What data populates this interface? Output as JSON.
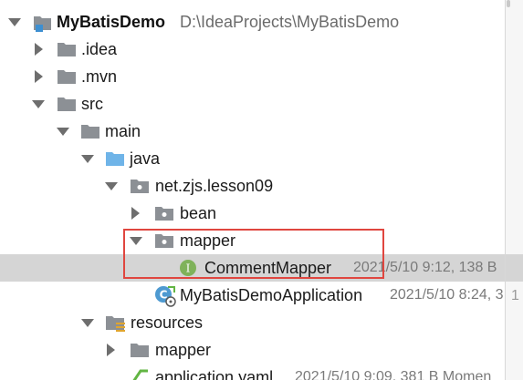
{
  "colors": {
    "selection": "#d5d5d5",
    "highlight_border": "#e0463f",
    "folder": "#8c9095",
    "source_folder": "#6fb4e8",
    "interface_badge": "#7fb25a",
    "meta_text": "#7a7a7a"
  },
  "tree": {
    "root": {
      "name": "MyBatisDemo",
      "path": "D:\\IdeaProjects\\MyBatisDemo",
      "icon": "module-icon",
      "expanded": true
    },
    "idea": {
      "name": ".idea",
      "icon": "folder-icon",
      "expanded": false
    },
    "mvn": {
      "name": ".mvn",
      "icon": "folder-icon",
      "expanded": false
    },
    "src": {
      "name": "src",
      "icon": "folder-icon",
      "expanded": true
    },
    "main": {
      "name": "main",
      "icon": "folder-icon",
      "expanded": true
    },
    "java": {
      "name": "java",
      "icon": "source-folder-icon",
      "expanded": true
    },
    "package": {
      "name": "net.zjs.lesson09",
      "icon": "package-icon",
      "expanded": true
    },
    "bean": {
      "name": "bean",
      "icon": "package-icon",
      "expanded": false
    },
    "mapper_pkg": {
      "name": "mapper",
      "icon": "package-icon",
      "expanded": true
    },
    "comment_mapper": {
      "name": "CommentMapper",
      "meta": "2021/5/10 9:12, 138 B",
      "icon": "interface-icon",
      "selected": true
    },
    "app_class": {
      "name": "MyBatisDemoApplication",
      "meta": "2021/5/10 8:24, 3",
      "icon": "spring-boot-class-icon"
    },
    "resources": {
      "name": "resources",
      "icon": "resources-folder-icon",
      "expanded": true
    },
    "res_mapper": {
      "name": "mapper",
      "icon": "folder-icon",
      "expanded": false
    },
    "app_yaml": {
      "name": "application.yaml",
      "meta": "2021/5/10 9:09, 381 B Momen",
      "icon": "yaml-file-icon"
    }
  },
  "side_panel": {
    "line_number": "1"
  }
}
